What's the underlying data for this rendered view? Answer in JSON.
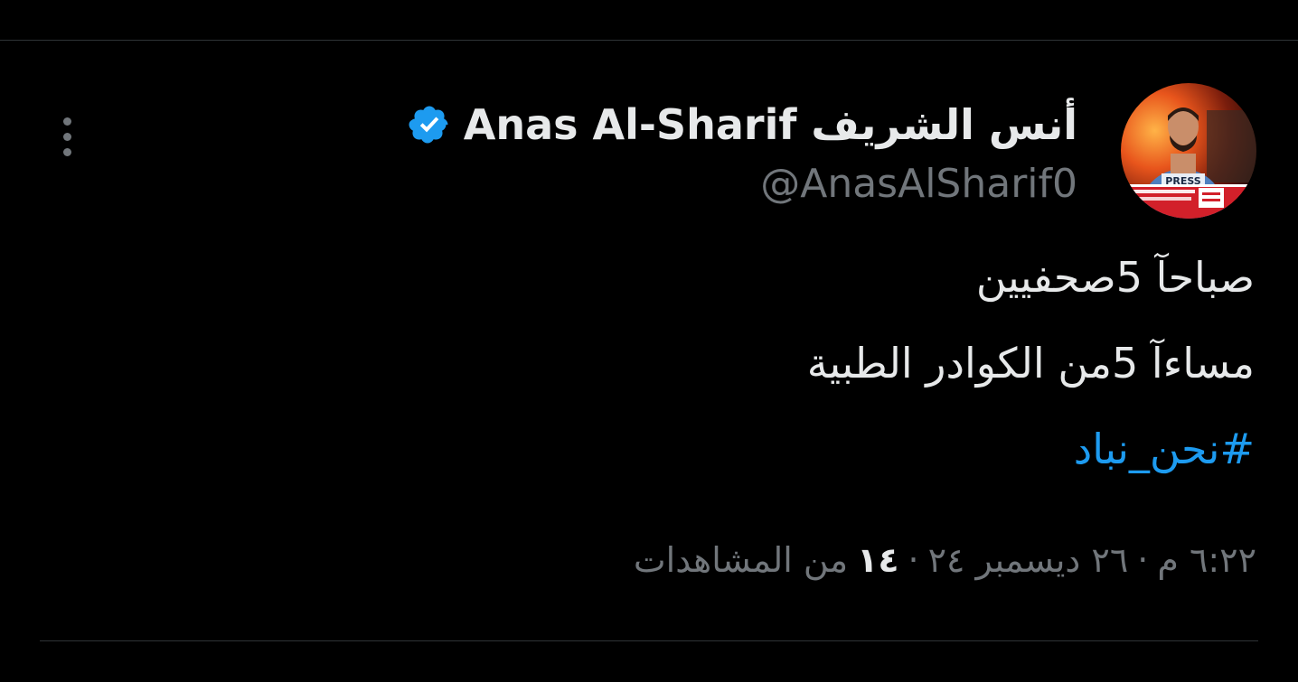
{
  "tweet": {
    "author": {
      "display_name": "أنس الشريف Anas Al-Sharif",
      "handle": "@AnasAlSharif0",
      "verified": true,
      "avatar_badge_text": "PRESS"
    },
    "lines": [
      "صباحآ 5صحفيين",
      "مساءآ 5من الكوادر الطبية"
    ],
    "hashtag": "#نحن_نباد",
    "meta": {
      "time": "٦:٢٢ م",
      "separator": "·",
      "date": "٢٦ ديسمبر ٢٤",
      "views_count": "١٤",
      "views_label": "من المشاهدات"
    }
  },
  "colors": {
    "background": "#000000",
    "text_primary": "#e7e9ea",
    "text_secondary": "#71767b",
    "accent": "#1d9bf0",
    "divider": "#2f3336"
  },
  "icons": {
    "more": "more-vertical-icon",
    "verified": "verified-badge-icon"
  }
}
